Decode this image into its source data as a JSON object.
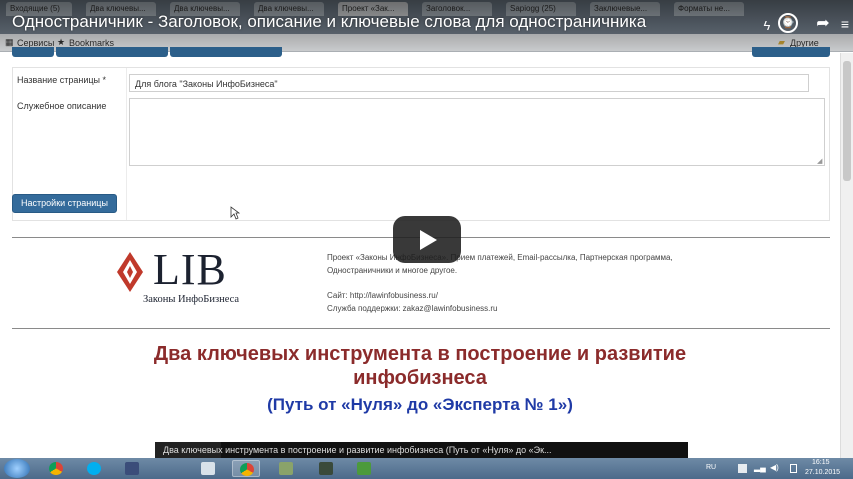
{
  "browser": {
    "tabs": [
      "Входящие (5)",
      "Два ключевы...",
      "Два ключевы...",
      "Два ключевы...",
      "Проект «Зак...",
      "Заголовок...",
      "Sapiogg (25)",
      "Заключевые...",
      "Форматы не..."
    ],
    "bookmarks": {
      "services_label": "Сервисы",
      "bookmarks_label": "Bookmarks",
      "other_label": "Другие закладки"
    }
  },
  "video": {
    "title": "Одностраничник - Заголовок, описание и ключевые слова для одностраничника",
    "strip_text": "Два ключевых инструмента в построение и развитие инфобизнеса (Путь от «Нуля» до «Эк..."
  },
  "form": {
    "page_name_label": "Название страницы *",
    "page_name_value": "Для блога \"Законы ИнфоБизнеса\"",
    "service_desc_label": "Служебное описание",
    "service_desc_value": "",
    "settings_button": "Настройки страницы"
  },
  "preview": {
    "logo_text": "LIB",
    "logo_subtitle": "Законы ИнфоБизнеса",
    "logo_color": "#c0392b",
    "project_line1": "Проект «Законы ИнфоБизнеса». Прием платежей, Email-рассылка, Партнерская программа,",
    "project_line2": "Одностраничники и многое другое.",
    "site_line": "Сайт: http://lawinfobusiness.ru/",
    "support_line": "Служба поддержки: zakaz@lawinfobusiness.ru",
    "headline_line1": "Два ключевых инструмента в построение и развитие",
    "headline_line2": "инфобизнеса",
    "subheadline": "(Путь от «Нуля» до «Эксперта № 1»)",
    "headline_color": "#8b2b2b",
    "subheadline_color": "#1f3aa6"
  },
  "taskbar": {
    "lang": "RU",
    "time": "16:15",
    "date": "27.10.2015"
  }
}
